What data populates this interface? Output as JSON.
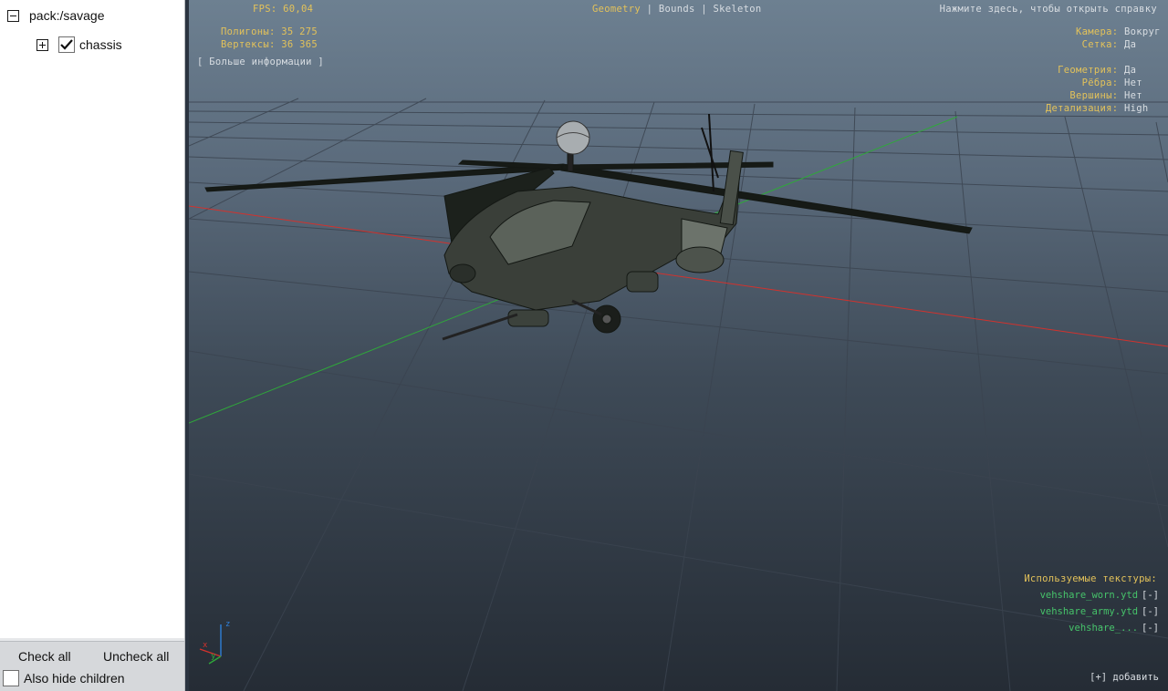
{
  "tree": {
    "root": {
      "label": "pack:/savage",
      "expanded": true
    },
    "child": {
      "label": "chassis",
      "checked": true,
      "expanded": false
    }
  },
  "bottom": {
    "check_all": "Check all",
    "uncheck_all": "Uncheck all",
    "also_hide_children": "Also hide children"
  },
  "hud": {
    "fps": "FPS: 60,04",
    "polygons": "Полигоны: 35 275",
    "vertices": "Вертексы: 36 365",
    "more_info": "[ Больше информации ]",
    "view_modes": [
      "Geometry",
      "Bounds",
      "Skeleton"
    ],
    "active_view_mode": "Geometry",
    "help": "Нажмите здесь, чтобы открыть справку",
    "camera_label": "Камера:",
    "camera_value": "Вокруг",
    "grid_label": "Сетка:",
    "grid_value": "Да",
    "geometry_label": "Геометрия:",
    "geometry_value": "Да",
    "edges_label": "Рёбра:",
    "edges_value": "Нет",
    "verts_label": "Вершины:",
    "verts_value": "Нет",
    "detail_label": "Детализация:",
    "detail_value": "High",
    "textures_title": "Используемые текстуры:",
    "textures": [
      "vehshare_worn.ytd",
      "vehshare_army.ytd",
      "vehshare_..."
    ],
    "remove_label": "[-]",
    "add_label": "[+] добавить"
  },
  "axes": {
    "x": "x",
    "y": "y",
    "z": "z"
  },
  "colors": {
    "hud_yellow": "#e3c25a",
    "hud_green": "#46c36a",
    "x_axis": "#d2322d",
    "y_axis": "#2fa83a"
  }
}
